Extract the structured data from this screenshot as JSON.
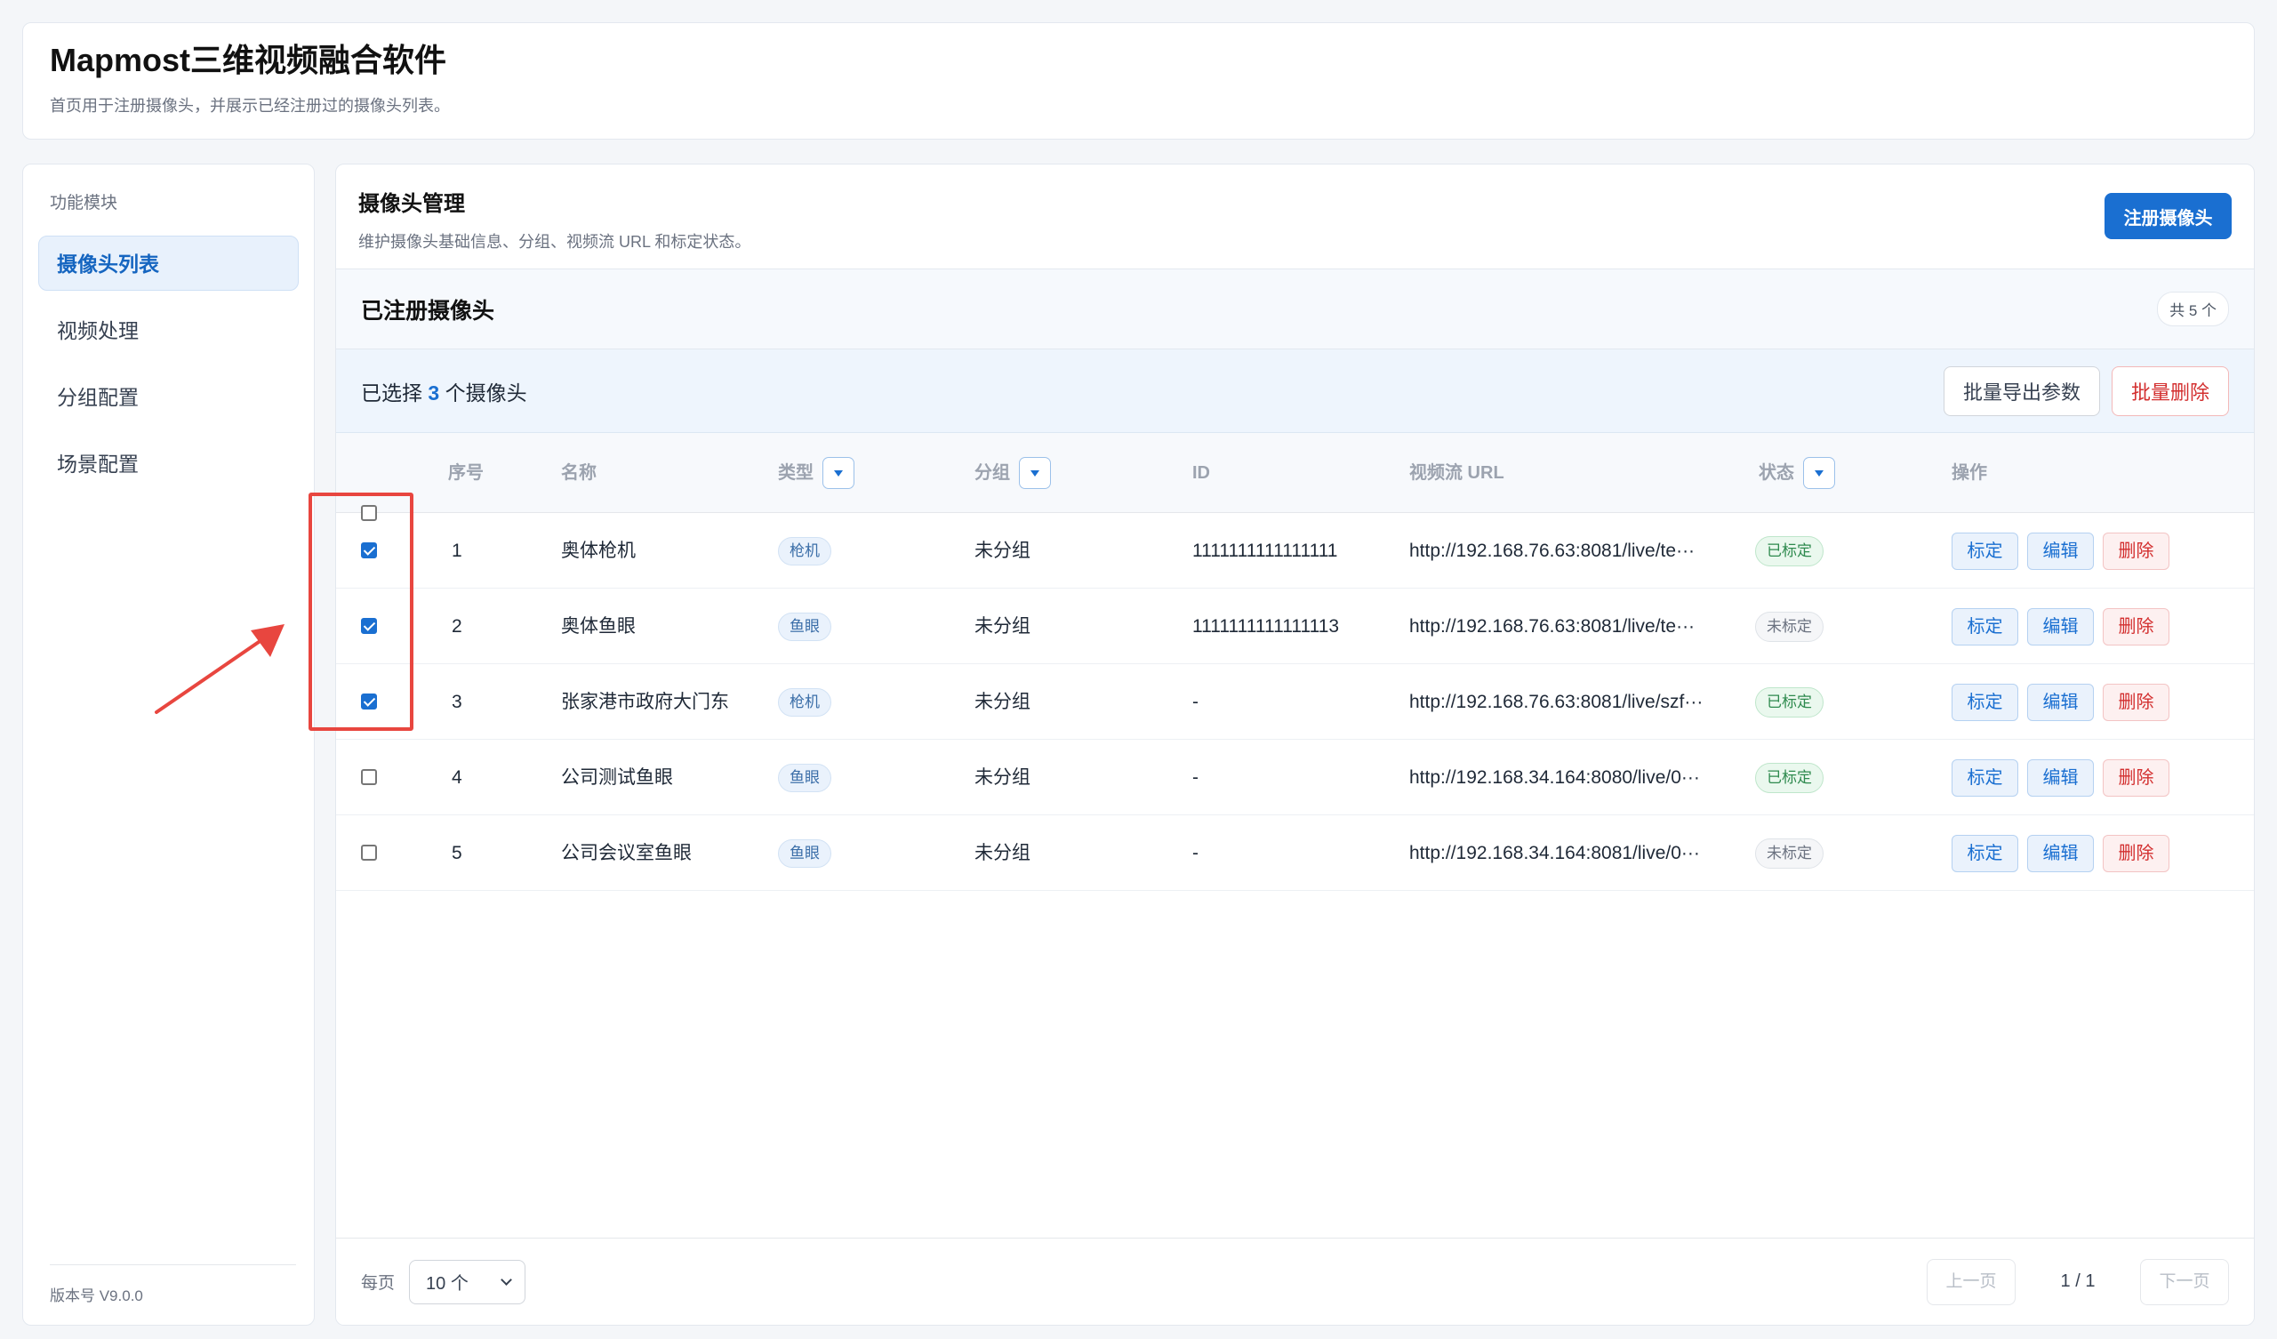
{
  "header": {
    "title": "Mapmost三维视频融合软件",
    "subtitle": "首页用于注册摄像头，并展示已经注册过的摄像头列表。"
  },
  "sidebar": {
    "section_label": "功能模块",
    "items": [
      {
        "label": "摄像头列表",
        "active": true
      },
      {
        "label": "视频处理",
        "active": false
      },
      {
        "label": "分组配置",
        "active": false
      },
      {
        "label": "场景配置",
        "active": false
      }
    ],
    "version": "版本号 V9.0.0"
  },
  "management": {
    "title": "摄像头管理",
    "description": "维护摄像头基础信息、分组、视频流 URL 和标定状态。",
    "register_button": "注册摄像头"
  },
  "registered": {
    "title": "已注册摄像头",
    "count_badge": "共 5 个"
  },
  "selection": {
    "prefix": "已选择",
    "count": "3",
    "suffix": "个摄像头",
    "export_button": "批量导出参数",
    "delete_button": "批量删除"
  },
  "table": {
    "columns": {
      "index": "序号",
      "name": "名称",
      "type": "类型",
      "group": "分组",
      "id": "ID",
      "url": "视频流 URL",
      "status": "状态",
      "actions": "操作"
    },
    "action_labels": {
      "calibrate": "标定",
      "edit": "编辑",
      "delete": "删除"
    },
    "rows": [
      {
        "checked": true,
        "index": "1",
        "name": "奥体枪机",
        "type": "枪机",
        "group": "未分组",
        "id": "1111111111111111",
        "url": "http://192.168.76.63:8081/live/te···",
        "status": "已标定",
        "status_kind": "ok"
      },
      {
        "checked": true,
        "index": "2",
        "name": "奥体鱼眼",
        "type": "鱼眼",
        "group": "未分组",
        "id": "1111111111111113",
        "url": "http://192.168.76.63:8081/live/te···",
        "status": "未标定",
        "status_kind": "no"
      },
      {
        "checked": true,
        "index": "3",
        "name": "张家港市政府大门东",
        "type": "枪机",
        "group": "未分组",
        "id": "-",
        "url": "http://192.168.76.63:8081/live/szf···",
        "status": "已标定",
        "status_kind": "ok"
      },
      {
        "checked": false,
        "index": "4",
        "name": "公司测试鱼眼",
        "type": "鱼眼",
        "group": "未分组",
        "id": "-",
        "url": "http://192.168.34.164:8080/live/0···",
        "status": "已标定",
        "status_kind": "ok"
      },
      {
        "checked": false,
        "index": "5",
        "name": "公司会议室鱼眼",
        "type": "鱼眼",
        "group": "未分组",
        "id": "-",
        "url": "http://192.168.34.164:8081/live/0···",
        "status": "未标定",
        "status_kind": "no"
      }
    ]
  },
  "pagination": {
    "per_page_label": "每页",
    "per_page_value": "10 个",
    "prev_label": "上一页",
    "page_indicator": "1 / 1",
    "next_label": "下一页"
  },
  "colors": {
    "primary": "#1a6fd1",
    "danger": "#d32f2f",
    "success": "#2e8a4e",
    "annotation": "#e8463f"
  }
}
